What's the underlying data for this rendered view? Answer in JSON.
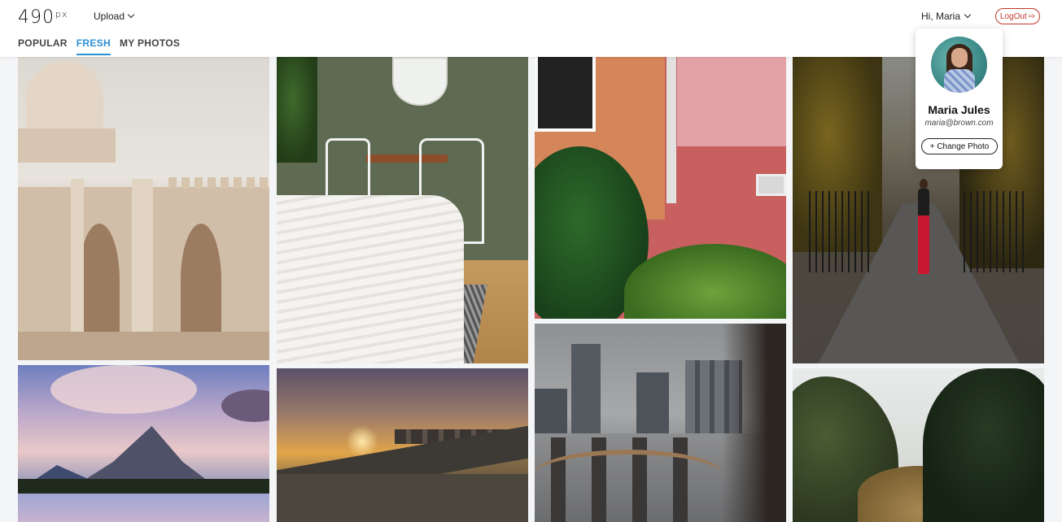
{
  "header": {
    "logo_text": "490",
    "logo_sup": "px",
    "upload_label": "Upload",
    "greeting": "Hi, Maria",
    "logout_label": "LogOut",
    "logout_icon": "⇨"
  },
  "tabs": [
    {
      "label": "POPULAR",
      "active": false
    },
    {
      "label": "FRESH",
      "active": true
    },
    {
      "label": "MY PHOTOS",
      "active": false
    }
  ],
  "profile_popup": {
    "name": "Maria Jules",
    "email": "maria@brown.com",
    "change_photo_label": "+ Change Photo"
  },
  "colors": {
    "accent": "#2b8fd6",
    "logout": "#c0392b"
  },
  "photos": [
    {
      "id": "dome-arches"
    },
    {
      "id": "white-bedroom"
    },
    {
      "id": "red-wall-bushes"
    },
    {
      "id": "tree-lined-path"
    },
    {
      "id": "mountain-lake"
    },
    {
      "id": "sunset-bridge"
    },
    {
      "id": "city-dock"
    },
    {
      "id": "pine-trees"
    }
  ]
}
